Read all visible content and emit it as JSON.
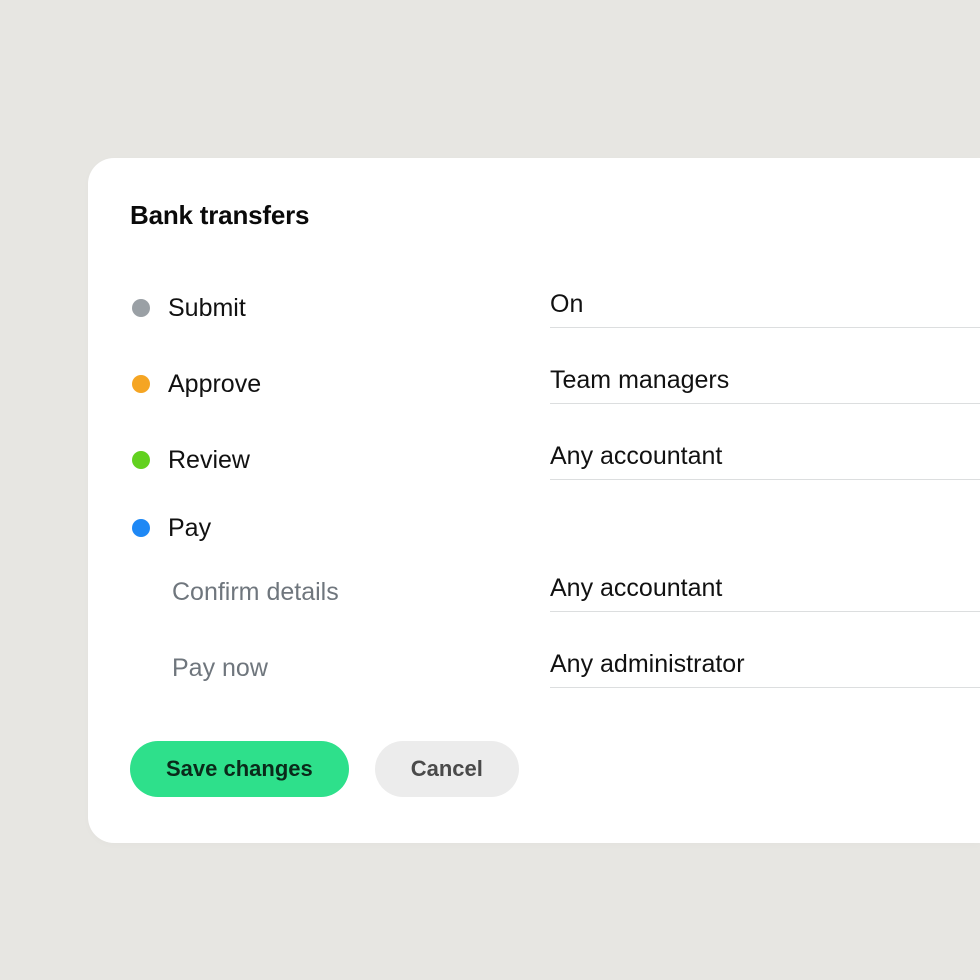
{
  "title": "Bank transfers",
  "colors": {
    "submit": "#9aa0a5",
    "approve": "#f5a523",
    "review": "#62d11f",
    "pay": "#1e88f5"
  },
  "rows": {
    "submit": {
      "label": "Submit",
      "value": "On"
    },
    "approve": {
      "label": "Approve",
      "value": "Team managers"
    },
    "review": {
      "label": "Review",
      "value": "Any accountant"
    },
    "pay": {
      "label": "Pay",
      "sub": {
        "confirm": {
          "label": "Confirm details",
          "value": "Any accountant"
        },
        "paynow": {
          "label": "Pay now",
          "value": "Any administrator"
        }
      }
    }
  },
  "actions": {
    "save": "Save changes",
    "cancel": "Cancel"
  }
}
